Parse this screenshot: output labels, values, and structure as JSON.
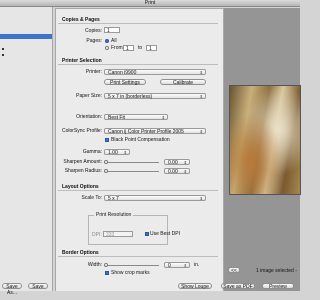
{
  "window": {
    "title": "Print"
  },
  "sections": {
    "copies_pages": "Copies & Pages",
    "printer_selection": "Printer Selection",
    "layout_options": "Layout Options",
    "border_options": "Border Options"
  },
  "copies": {
    "label": "Copies:",
    "value": "1"
  },
  "pages": {
    "label": "Pages:",
    "all_label": "All",
    "from_label": "From",
    "from_value": "1",
    "to_label": "to",
    "to_value": "1",
    "selected": "All"
  },
  "printer": {
    "label": "Printer:",
    "value": "Canon i9900",
    "settings_button": "Print Settings",
    "calibrate_button": "Calibrate"
  },
  "paper_size": {
    "label": "Paper Size:",
    "value": "5 x 7 in (borderless)"
  },
  "orientation": {
    "label": "Orientation:",
    "value": "Best Fit"
  },
  "colorsync": {
    "label": "ColorSync Profile:",
    "value": "Canon ij Color Printer Profile 2005",
    "bpc_label": "Black Point Compensation",
    "bpc_checked": true
  },
  "gamma": {
    "label": "Gamma:",
    "value": "1.00"
  },
  "sharpen_amount": {
    "label": "Sharpen Amount:",
    "value": "0.00"
  },
  "sharpen_radius": {
    "label": "Sharpen Radius:",
    "value": "0.00"
  },
  "scale_to": {
    "label": "Scale To:",
    "value": "5 x 7"
  },
  "print_resolution": {
    "title": "Print Resolution",
    "dpi_label": "DPI:",
    "dpi_value": "333",
    "best_dpi_label": "Use Best DPI",
    "best_dpi_checked": true
  },
  "border": {
    "width_label": "Width:",
    "width_value": "0",
    "unit": "in.",
    "crop_label": "Show crop marks",
    "crop_checked": true
  },
  "preview": {
    "status": "1 image selected -",
    "nav_label": "<<"
  },
  "footer": {
    "save_as_button": "Save As...",
    "save_button": "Save",
    "show_loupe_button": "Show Loupe",
    "save_pdf_button": "Save as PDF",
    "preview_button": "Preview"
  }
}
